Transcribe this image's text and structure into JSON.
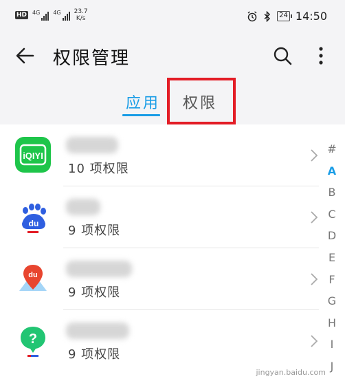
{
  "status_bar": {
    "hd_badge": "HD",
    "network_1": "4G",
    "network_2": "4G",
    "speed_value": "23.7",
    "speed_unit": "K/s",
    "battery": "24",
    "time": "14:50"
  },
  "header": {
    "title": "权限管理"
  },
  "tabs": [
    {
      "label": "应用",
      "active": true
    },
    {
      "label": "权限",
      "active": false
    }
  ],
  "apps": [
    {
      "permission_count": "10 项权限",
      "icon": "iqiyi-icon",
      "icon_text": "iQIYI"
    },
    {
      "permission_count": "9 项权限",
      "icon": "baidu-icon",
      "icon_text": "du"
    },
    {
      "permission_count": "9 项权限",
      "icon": "baidu-map-icon",
      "icon_text": "du"
    },
    {
      "permission_count": "9 项权限",
      "icon": "help-icon",
      "icon_text": "?"
    }
  ],
  "alphabet_index": [
    "#",
    "A",
    "B",
    "C",
    "D",
    "E",
    "F",
    "G",
    "H",
    "I",
    "J"
  ],
  "alphabet_active": "A",
  "colors": {
    "accent": "#1a9de6",
    "annotation": "#e31d26",
    "iqiyi_green": "#1ec54a",
    "baidu_blue": "#2f5fe0"
  },
  "watermark": "jingyan.baidu.com"
}
